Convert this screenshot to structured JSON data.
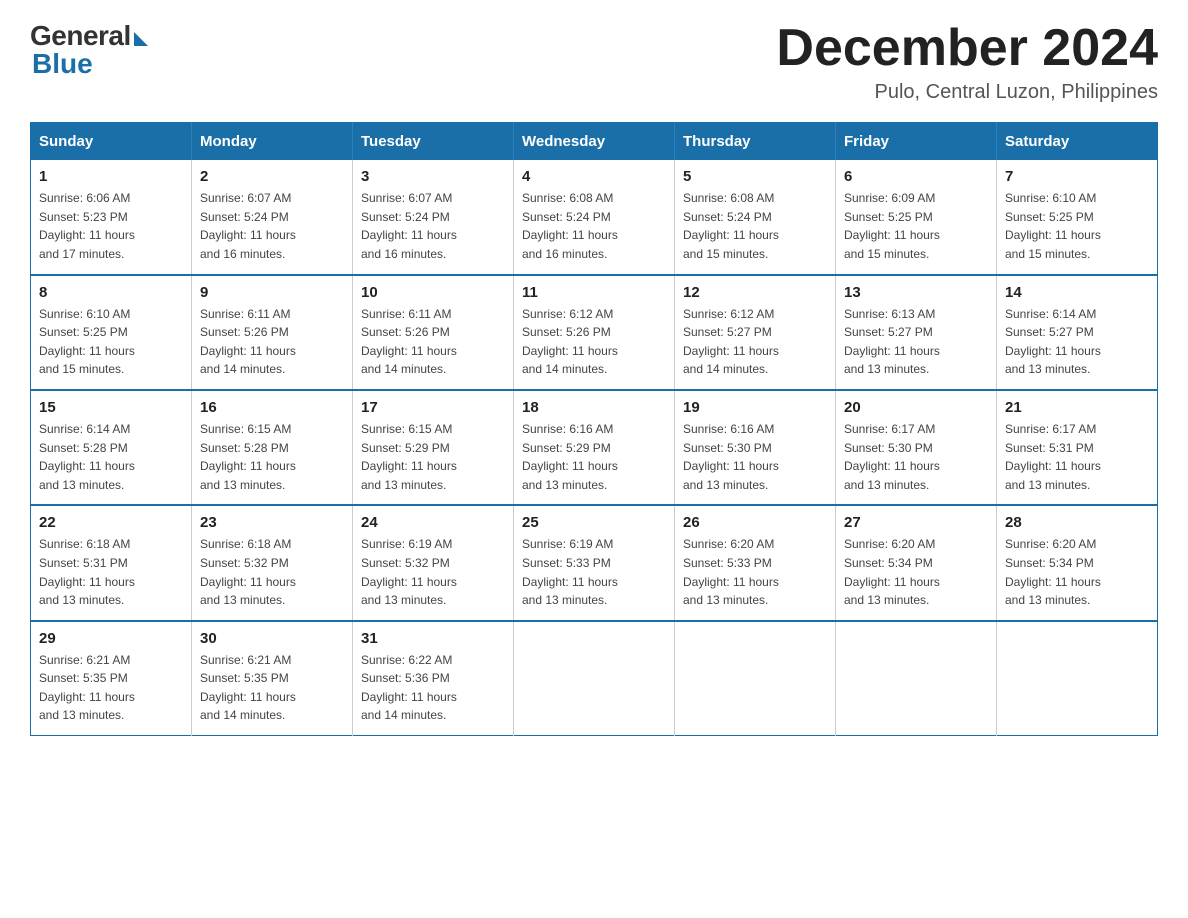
{
  "logo": {
    "general": "General",
    "blue": "Blue"
  },
  "title": {
    "month_year": "December 2024",
    "location": "Pulo, Central Luzon, Philippines"
  },
  "days_of_week": [
    "Sunday",
    "Monday",
    "Tuesday",
    "Wednesday",
    "Thursday",
    "Friday",
    "Saturday"
  ],
  "weeks": [
    [
      {
        "day": "1",
        "sunrise": "6:06 AM",
        "sunset": "5:23 PM",
        "daylight": "11 hours and 17 minutes."
      },
      {
        "day": "2",
        "sunrise": "6:07 AM",
        "sunset": "5:24 PM",
        "daylight": "11 hours and 16 minutes."
      },
      {
        "day": "3",
        "sunrise": "6:07 AM",
        "sunset": "5:24 PM",
        "daylight": "11 hours and 16 minutes."
      },
      {
        "day": "4",
        "sunrise": "6:08 AM",
        "sunset": "5:24 PM",
        "daylight": "11 hours and 16 minutes."
      },
      {
        "day": "5",
        "sunrise": "6:08 AM",
        "sunset": "5:24 PM",
        "daylight": "11 hours and 15 minutes."
      },
      {
        "day": "6",
        "sunrise": "6:09 AM",
        "sunset": "5:25 PM",
        "daylight": "11 hours and 15 minutes."
      },
      {
        "day": "7",
        "sunrise": "6:10 AM",
        "sunset": "5:25 PM",
        "daylight": "11 hours and 15 minutes."
      }
    ],
    [
      {
        "day": "8",
        "sunrise": "6:10 AM",
        "sunset": "5:25 PM",
        "daylight": "11 hours and 15 minutes."
      },
      {
        "day": "9",
        "sunrise": "6:11 AM",
        "sunset": "5:26 PM",
        "daylight": "11 hours and 14 minutes."
      },
      {
        "day": "10",
        "sunrise": "6:11 AM",
        "sunset": "5:26 PM",
        "daylight": "11 hours and 14 minutes."
      },
      {
        "day": "11",
        "sunrise": "6:12 AM",
        "sunset": "5:26 PM",
        "daylight": "11 hours and 14 minutes."
      },
      {
        "day": "12",
        "sunrise": "6:12 AM",
        "sunset": "5:27 PM",
        "daylight": "11 hours and 14 minutes."
      },
      {
        "day": "13",
        "sunrise": "6:13 AM",
        "sunset": "5:27 PM",
        "daylight": "11 hours and 13 minutes."
      },
      {
        "day": "14",
        "sunrise": "6:14 AM",
        "sunset": "5:27 PM",
        "daylight": "11 hours and 13 minutes."
      }
    ],
    [
      {
        "day": "15",
        "sunrise": "6:14 AM",
        "sunset": "5:28 PM",
        "daylight": "11 hours and 13 minutes."
      },
      {
        "day": "16",
        "sunrise": "6:15 AM",
        "sunset": "5:28 PM",
        "daylight": "11 hours and 13 minutes."
      },
      {
        "day": "17",
        "sunrise": "6:15 AM",
        "sunset": "5:29 PM",
        "daylight": "11 hours and 13 minutes."
      },
      {
        "day": "18",
        "sunrise": "6:16 AM",
        "sunset": "5:29 PM",
        "daylight": "11 hours and 13 minutes."
      },
      {
        "day": "19",
        "sunrise": "6:16 AM",
        "sunset": "5:30 PM",
        "daylight": "11 hours and 13 minutes."
      },
      {
        "day": "20",
        "sunrise": "6:17 AM",
        "sunset": "5:30 PM",
        "daylight": "11 hours and 13 minutes."
      },
      {
        "day": "21",
        "sunrise": "6:17 AM",
        "sunset": "5:31 PM",
        "daylight": "11 hours and 13 minutes."
      }
    ],
    [
      {
        "day": "22",
        "sunrise": "6:18 AM",
        "sunset": "5:31 PM",
        "daylight": "11 hours and 13 minutes."
      },
      {
        "day": "23",
        "sunrise": "6:18 AM",
        "sunset": "5:32 PM",
        "daylight": "11 hours and 13 minutes."
      },
      {
        "day": "24",
        "sunrise": "6:19 AM",
        "sunset": "5:32 PM",
        "daylight": "11 hours and 13 minutes."
      },
      {
        "day": "25",
        "sunrise": "6:19 AM",
        "sunset": "5:33 PM",
        "daylight": "11 hours and 13 minutes."
      },
      {
        "day": "26",
        "sunrise": "6:20 AM",
        "sunset": "5:33 PM",
        "daylight": "11 hours and 13 minutes."
      },
      {
        "day": "27",
        "sunrise": "6:20 AM",
        "sunset": "5:34 PM",
        "daylight": "11 hours and 13 minutes."
      },
      {
        "day": "28",
        "sunrise": "6:20 AM",
        "sunset": "5:34 PM",
        "daylight": "11 hours and 13 minutes."
      }
    ],
    [
      {
        "day": "29",
        "sunrise": "6:21 AM",
        "sunset": "5:35 PM",
        "daylight": "11 hours and 13 minutes."
      },
      {
        "day": "30",
        "sunrise": "6:21 AM",
        "sunset": "5:35 PM",
        "daylight": "11 hours and 14 minutes."
      },
      {
        "day": "31",
        "sunrise": "6:22 AM",
        "sunset": "5:36 PM",
        "daylight": "11 hours and 14 minutes."
      },
      null,
      null,
      null,
      null
    ]
  ],
  "labels": {
    "sunrise": "Sunrise:",
    "sunset": "Sunset:",
    "daylight": "Daylight:"
  }
}
